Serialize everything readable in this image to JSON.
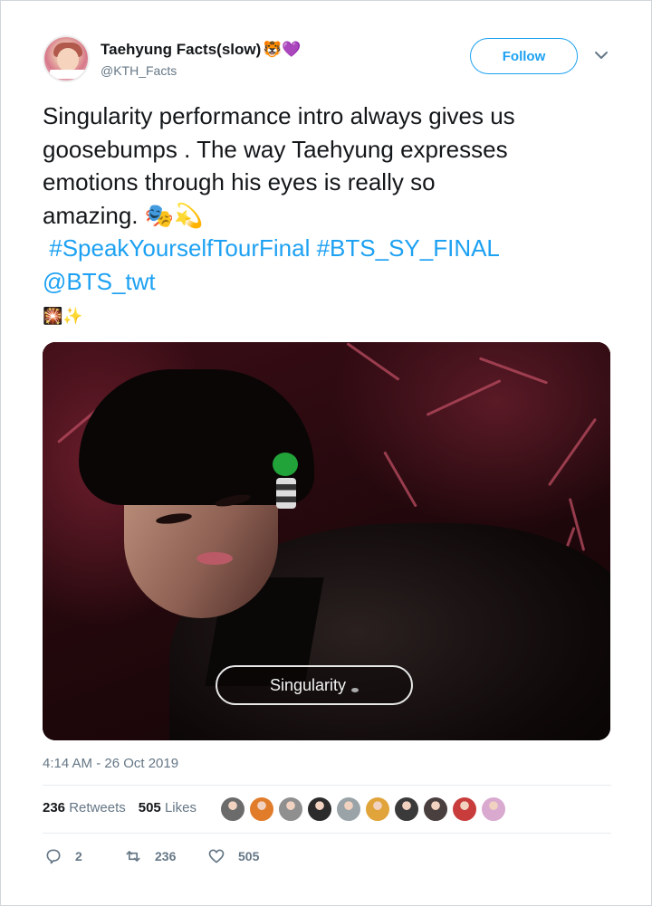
{
  "user": {
    "name": "Taehyung Facts(slow)",
    "name_emoji": "🐯💜",
    "handle": "@KTH_Facts",
    "follow_label": "Follow"
  },
  "tweet": {
    "line1": "Singularity performance intro always gives us",
    "line2": "goosebumps . The way Taehyung expresses",
    "line3": "emotions through his eyes is really so",
    "line4_text": "amazing.",
    "line4_emoji": "🎭💫",
    "hashtag1": "#SpeakYourselfTourFinal",
    "hashtag2": "#BTS_SY_FINAL",
    "mention": "@BTS_twt",
    "trailing_emoji": "🎇✨"
  },
  "media": {
    "caption": "Singularity"
  },
  "timestamp": "4:14 AM - 26 Oct 2019",
  "stats": {
    "retweets_count": "236",
    "retweets_label": "Retweets",
    "likes_count": "505",
    "likes_label": "Likes",
    "liker_colors": [
      "#6b6b6b",
      "#e07c2a",
      "#8f8f8f",
      "#2b2b2b",
      "#9aa3a8",
      "#e0a43a",
      "#3a3a3a",
      "#4a3f3f",
      "#c93c3c",
      "#d9a9d0"
    ]
  },
  "actions": {
    "reply_count": "2",
    "retweet_count": "236",
    "like_count": "505"
  },
  "colors": {
    "accent": "#1da1f2",
    "text": "#14171a",
    "muted": "#657786"
  }
}
